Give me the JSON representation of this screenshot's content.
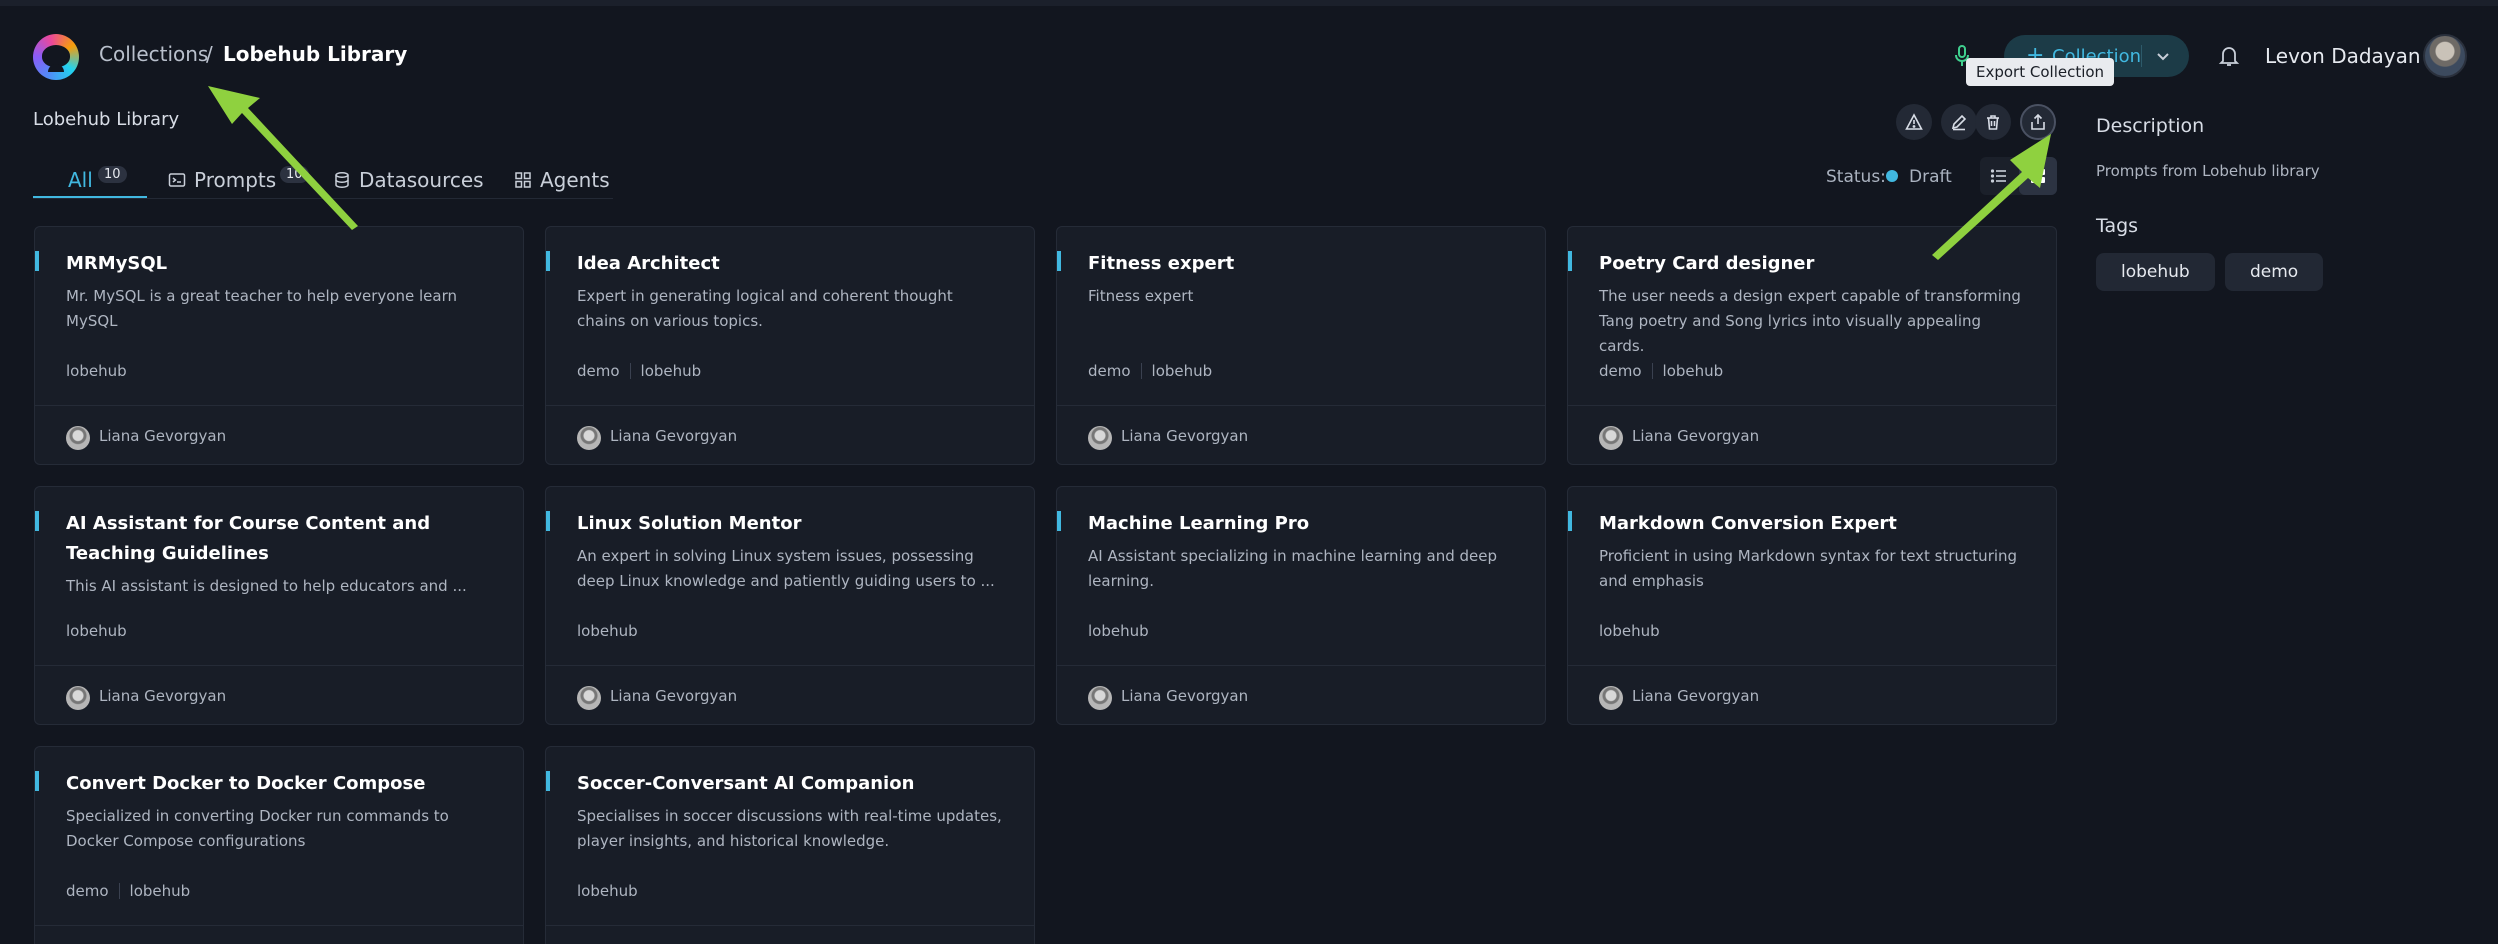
{
  "header": {
    "breadcrumb": {
      "root": "Collections",
      "separator": "/",
      "current": "Lobehub Library"
    },
    "collection_button": {
      "plus": "+",
      "label": "Collection"
    },
    "tooltip": "Export Collection",
    "user_name": "Levon Dadayan"
  },
  "page": {
    "title": "Lobehub Library"
  },
  "tabs": [
    {
      "label": "All",
      "count": "10",
      "active": true
    },
    {
      "label": "Prompts",
      "count": "10"
    },
    {
      "label": "Datasources"
    },
    {
      "label": "Agents"
    }
  ],
  "status": {
    "label": "Status:",
    "value": "Draft",
    "color": "#41b8e0"
  },
  "cards": [
    {
      "title": "MRMySQL",
      "desc": "Mr. MySQL is a great teacher to help everyone learn MySQL",
      "tags": [
        "lobehub"
      ],
      "author": "Liana Gevorgyan"
    },
    {
      "title": "Idea Architect",
      "desc": "Expert in generating logical and coherent thought chains on various topics.",
      "tags": [
        "demo",
        "lobehub"
      ],
      "author": "Liana Gevorgyan"
    },
    {
      "title": "Fitness expert",
      "desc": "Fitness expert",
      "tags": [
        "demo",
        "lobehub"
      ],
      "author": "Liana Gevorgyan"
    },
    {
      "title": "Poetry Card designer",
      "desc": "The user needs a design expert capable of transforming Tang poetry and Song lyrics into visually appealing cards.",
      "tags": [
        "demo",
        "lobehub"
      ],
      "author": "Liana Gevorgyan"
    },
    {
      "title": "AI Assistant for Course Content and Teaching Guidelines",
      "desc": "This AI assistant is designed to help educators and ...",
      "tags": [
        "lobehub"
      ],
      "author": "Liana Gevorgyan"
    },
    {
      "title": "Linux Solution Mentor",
      "desc": "An expert in solving Linux system issues, possessing deep Linux knowledge and patiently guiding users to ...",
      "tags": [
        "lobehub"
      ],
      "author": "Liana Gevorgyan"
    },
    {
      "title": "Machine Learning Pro",
      "desc": "AI Assistant specializing in machine learning and deep learning.",
      "tags": [
        "lobehub"
      ],
      "author": "Liana Gevorgyan"
    },
    {
      "title": "Markdown Conversion Expert",
      "desc": "Proficient in using Markdown syntax for text structuring and emphasis",
      "tags": [
        "lobehub"
      ],
      "author": "Liana Gevorgyan"
    },
    {
      "title": "Convert Docker to Docker Compose",
      "desc": "Specialized in converting Docker run commands to Docker Compose configurations",
      "tags": [
        "demo",
        "lobehub"
      ],
      "author": ""
    },
    {
      "title": "Soccer-Conversant AI Companion",
      "desc": "Specialises in soccer discussions with real-time updates, player insights, and historical knowledge.",
      "tags": [
        "lobehub"
      ],
      "author": ""
    }
  ],
  "panel": {
    "description_heading": "Description",
    "description": "Prompts from Lobehub library",
    "tags_heading": "Tags",
    "tags": [
      "lobehub",
      "demo"
    ]
  },
  "colors": {
    "accent": "#41b8e0",
    "annotation_arrow": "#8fd13f",
    "background": "#12161f"
  },
  "icons": {
    "actions": [
      "warning-triangle-icon",
      "edit-pencil-icon",
      "trash-icon",
      "export-share-icon"
    ],
    "header": [
      "mic-icon",
      "bell-icon",
      "chevron-down-icon"
    ],
    "tabs": [
      "prompt-icon",
      "database-icon",
      "grid-icon"
    ],
    "views": [
      "list-view-icon",
      "grid-view-icon"
    ]
  }
}
